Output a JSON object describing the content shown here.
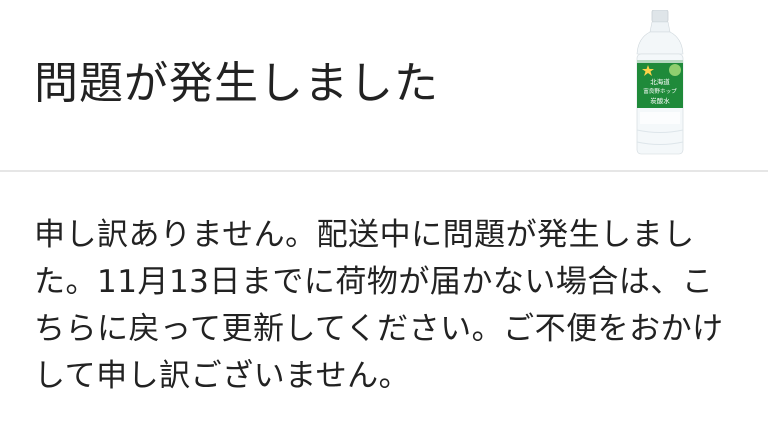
{
  "error": {
    "title": "問題が発生しました",
    "message": "申し訳ありません。配送中に問題が発生しました。11月13日までに荷物が届かない場合は、こちらに戻って更新してください。ご不便をおかけして申し訳ございません。"
  },
  "product_image": {
    "icon": "sparkling-water-bottle-icon",
    "label_lines": [
      "北海道",
      "富良野ホップ",
      "炭酸水"
    ],
    "cap_color": "#e9eef1",
    "label_color": "#1f8a3a"
  }
}
